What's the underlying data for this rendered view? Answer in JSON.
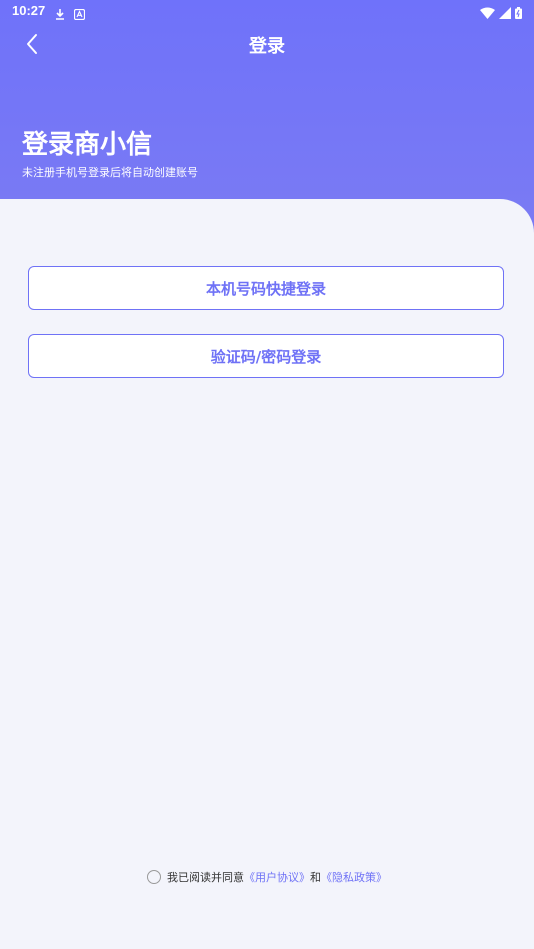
{
  "status_bar": {
    "time": "10:27"
  },
  "nav": {
    "title": "登录"
  },
  "hero": {
    "title": "登录商小信",
    "subtitle": "未注册手机号登录后将自动创建账号"
  },
  "buttons": {
    "quick_login": "本机号码快捷登录",
    "code_password_login": "验证码/密码登录"
  },
  "agreement": {
    "prefix": "我已阅读并同意",
    "user_agreement": "《用户协议》",
    "and": "和",
    "privacy_policy": "《隐私政策》"
  },
  "colors": {
    "primary": "#6F72F6",
    "header_gradient_top": "#6F72FA",
    "background": "#F3F4FB"
  }
}
